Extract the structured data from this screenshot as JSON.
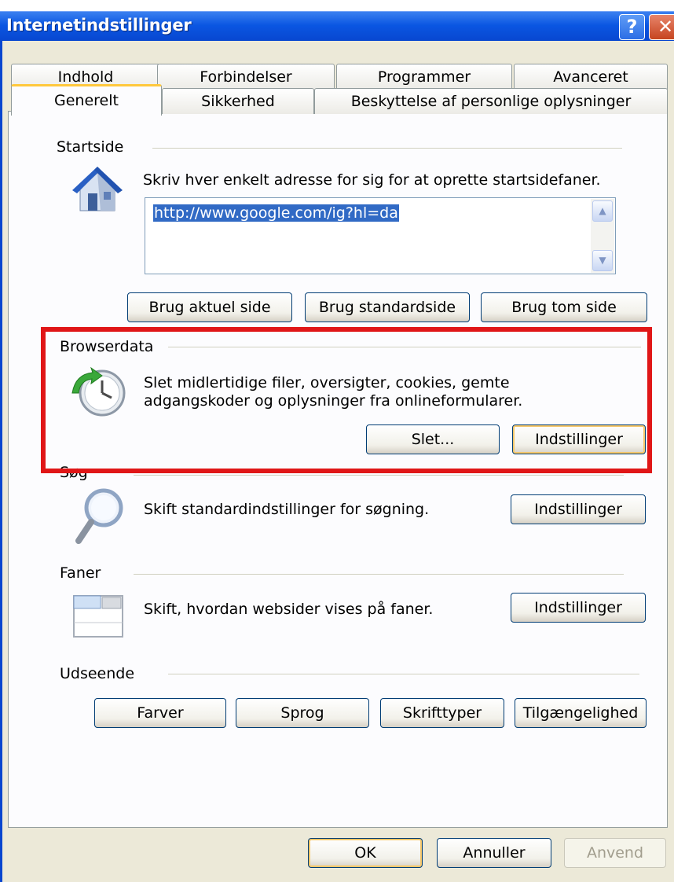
{
  "window": {
    "title": "Internetindstillinger",
    "help_glyph": "?",
    "close_glyph": "✕"
  },
  "tabs": {
    "row1": [
      "Indhold",
      "Forbindelser",
      "Programmer",
      "Avanceret"
    ],
    "row2": [
      "Generelt",
      "Sikkerhed",
      "Beskyttelse af personlige oplysninger"
    ],
    "active": "Generelt"
  },
  "startside": {
    "heading": "Startside",
    "description": "Skriv hver enkelt adresse for sig for at oprette startsidefaner.",
    "value": "http://www.google.com/ig?hl=da",
    "buttons": [
      "Brug aktuel side",
      "Brug standardside",
      "Brug tom side"
    ]
  },
  "browserdata": {
    "heading": "Browserdata",
    "line1": "Slet midlertidige filer, oversigter, cookies, gemte",
    "line2": "adgangskoder og oplysninger fra onlineformularer.",
    "delete_button": "Slet...",
    "settings_button": "Indstillinger"
  },
  "sog": {
    "heading": "Søg",
    "description": "Skift standardindstillinger for søgning.",
    "settings_button": "Indstillinger"
  },
  "faner": {
    "heading": "Faner",
    "description": "Skift, hvordan websider vises på faner.",
    "settings_button": "Indstillinger"
  },
  "udseende": {
    "heading": "Udseende",
    "buttons": [
      "Farver",
      "Sprog",
      "Skrifttyper",
      "Tilgængelighed"
    ]
  },
  "footer": {
    "ok": "OK",
    "cancel": "Annuller",
    "apply": "Anvend"
  },
  "colors": {
    "titlebar": "#0a56e2",
    "highlight_box": "#e01617",
    "dialog_bg": "#ece9d8"
  },
  "icons": {
    "startside": "home-icon",
    "browserdata": "history-clock-icon",
    "sog": "magnifier-icon",
    "faner": "tabs-icon"
  }
}
